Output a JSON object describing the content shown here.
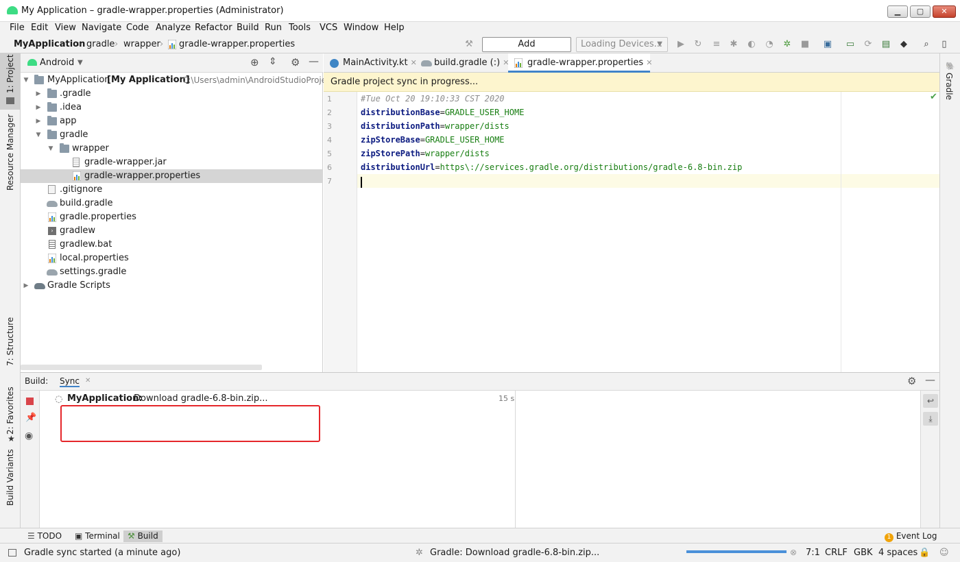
{
  "window": {
    "title": "My Application – gradle-wrapper.properties (Administrator)",
    "controls": [
      "minimize",
      "maximize",
      "close"
    ]
  },
  "menu": [
    "File",
    "Edit",
    "View",
    "Navigate",
    "Code",
    "Analyze",
    "Refactor",
    "Build",
    "Run",
    "Tools",
    "VCS",
    "Window",
    "Help"
  ],
  "breadcrumb": {
    "items": [
      "MyApplication",
      "gradle",
      "wrapper",
      "gradle-wrapper.properties"
    ]
  },
  "toolbar": {
    "add_configuration": "Add Configuration...",
    "devices": "Loading Devices..."
  },
  "left_stripe": [
    "1: Project",
    "Resource Manager",
    "7: Structure",
    "2: Favorites",
    "Build Variants"
  ],
  "right_stripe": [
    "Gradle"
  ],
  "project": {
    "view_mode": "Android",
    "root_name": "MyApplication",
    "root_module": "[My Application]",
    "root_path": "C:\\Users\\admin\\AndroidStudioProje",
    "items": [
      {
        "label": "MyApplication",
        "icon": "module-folder-icon"
      },
      {
        "label": ".gradle",
        "icon": "folder-icon"
      },
      {
        "label": ".idea",
        "icon": "folder-icon"
      },
      {
        "label": "app",
        "icon": "folder-icon"
      },
      {
        "label": "gradle",
        "icon": "folder-icon"
      },
      {
        "label": "wrapper",
        "icon": "folder-icon"
      },
      {
        "label": "gradle-wrapper.jar",
        "icon": "jar-icon"
      },
      {
        "label": "gradle-wrapper.properties",
        "icon": "properties-icon"
      },
      {
        "label": ".gitignore",
        "icon": "gitignore-icon"
      },
      {
        "label": "build.gradle",
        "icon": "gradle-icon"
      },
      {
        "label": "gradle.properties",
        "icon": "properties-icon"
      },
      {
        "label": "gradlew",
        "icon": "script-icon"
      },
      {
        "label": "gradlew.bat",
        "icon": "text-file-icon"
      },
      {
        "label": "local.properties",
        "icon": "properties-icon"
      },
      {
        "label": "settings.gradle",
        "icon": "gradle-icon"
      },
      {
        "label": "Gradle Scripts",
        "icon": "gradle-scripts-icon"
      }
    ]
  },
  "editor": {
    "tabs": [
      {
        "label": "MainActivity.kt",
        "icon": "kotlin-class-icon"
      },
      {
        "label": "build.gradle (:)",
        "icon": "gradle-icon"
      },
      {
        "label": "gradle-wrapper.properties",
        "icon": "properties-icon",
        "active": true
      }
    ],
    "banner": "Gradle project sync in progress...",
    "lines": [
      {
        "num": "1",
        "comment": "#Tue Oct 20 19:10:33 CST 2020"
      },
      {
        "num": "2",
        "key": "distributionBase",
        "value": "GRADLE_USER_HOME"
      },
      {
        "num": "3",
        "key": "distributionPath",
        "value": "wrapper/dists"
      },
      {
        "num": "4",
        "key": "zipStoreBase",
        "value": "GRADLE_USER_HOME"
      },
      {
        "num": "5",
        "key": "zipStorePath",
        "value": "wrapper/dists"
      },
      {
        "num": "6",
        "key": "distributionUrl",
        "value": "https\\://services.gradle.org/distributions/gradle-6.8-bin.zip"
      },
      {
        "num": "7"
      }
    ]
  },
  "build": {
    "label": "Build:",
    "tab": "Sync",
    "task_project": "MyApplication:",
    "task_text": "Download gradle-6.8-bin.zip...",
    "elapsed": "15 s"
  },
  "bottom_tools": [
    "TODO",
    "Terminal",
    "Build"
  ],
  "event_log": {
    "count": "1",
    "label": "Event Log"
  },
  "status": {
    "left": "Gradle sync started (a minute ago)",
    "task": "Gradle: Download gradle-6.8-bin.zip...",
    "progress": 1.0,
    "position": "7:1",
    "line_sep": "CRLF",
    "encoding": "GBK",
    "indent": "4 spaces"
  },
  "colors": {
    "selection": "#d5d5d5",
    "banner": "#fdf5ce",
    "highlight_box": "#e5262a",
    "property_key": "#0b1a80",
    "property_value": "#167d10"
  }
}
